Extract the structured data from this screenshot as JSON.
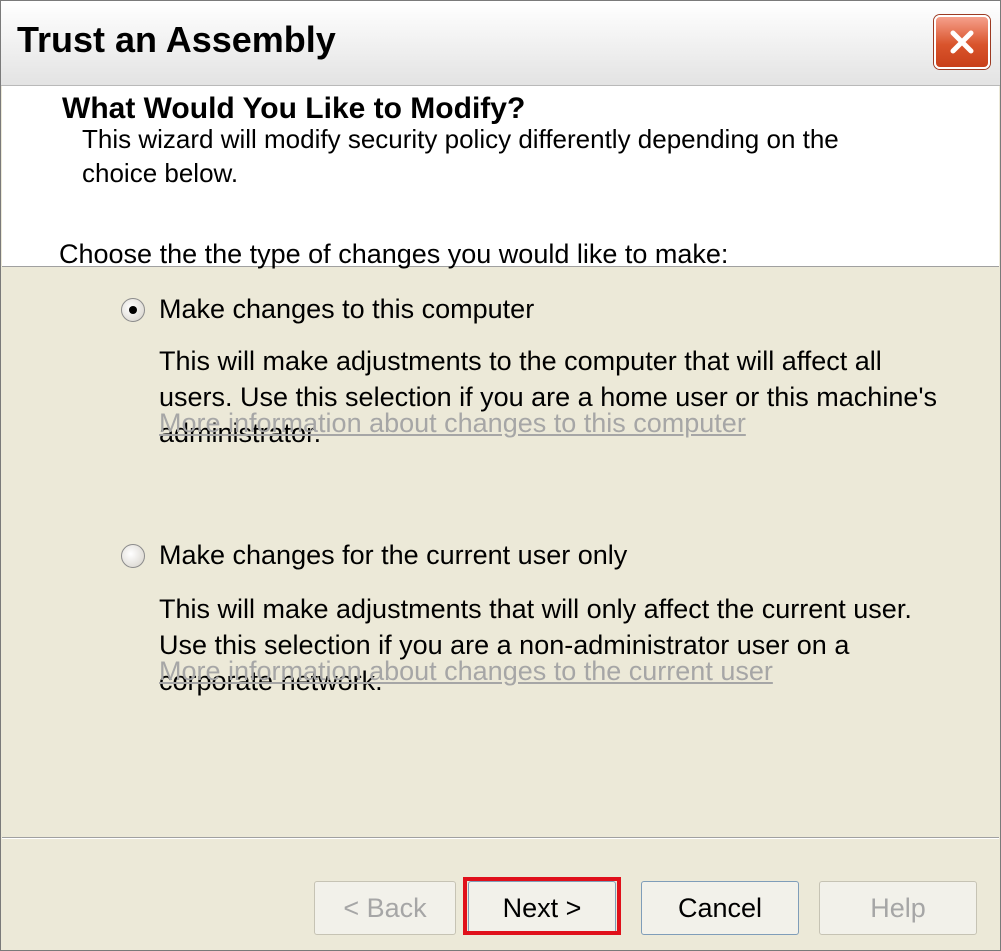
{
  "window": {
    "title": "Trust an Assembly"
  },
  "header": {
    "title": "What Would You Like to Modify?",
    "subtitle": "This wizard will modify security policy differently depending on the choice below."
  },
  "body": {
    "prompt": "Choose the the type of changes you would like to make:",
    "options": [
      {
        "label": "Make changes to this computer",
        "selected": true,
        "description": "This will make adjustments to the computer that will affect all users.  Use this selection if you are a home user or this machine's administrator.",
        "link": "More information about changes to this computer"
      },
      {
        "label": "Make changes for the current user only",
        "selected": false,
        "description": "This will make adjustments that will only affect the current user.  Use this selection if you are a non-administrator user on a corporate network.",
        "link": "More information about changes to the current user"
      }
    ]
  },
  "buttons": {
    "back": "< Back",
    "next": "Next >",
    "cancel": "Cancel",
    "help": "Help"
  },
  "colors": {
    "highlight": "#e0101a",
    "close": "#d9542c"
  }
}
